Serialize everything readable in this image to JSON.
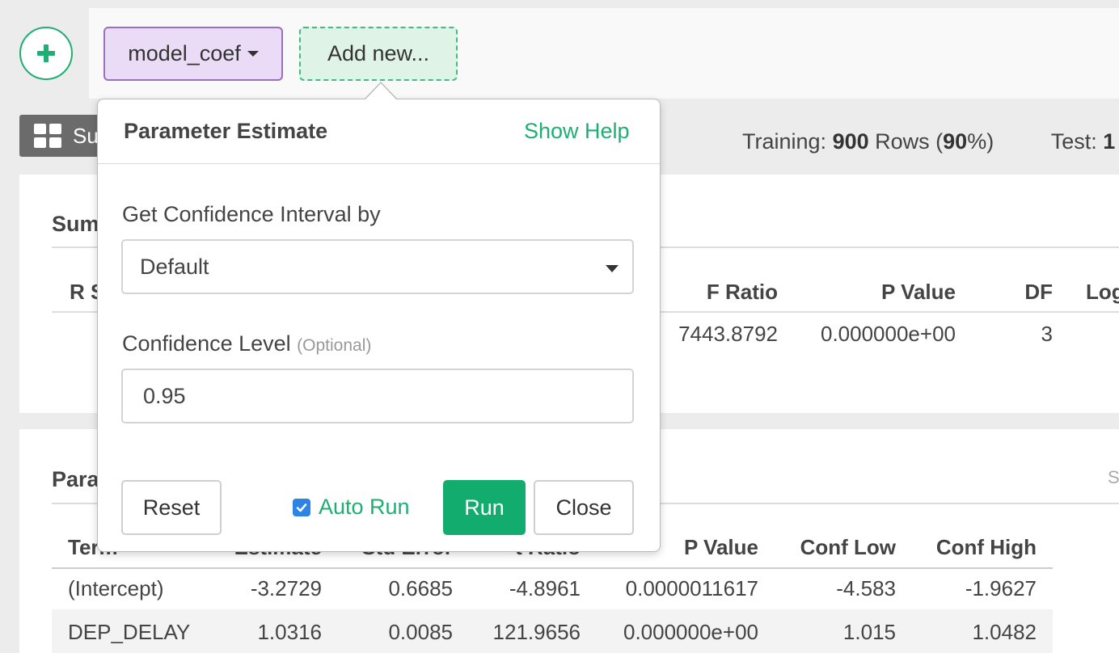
{
  "header": {
    "step_tab_label": "model_coef",
    "add_new_label": "Add new..."
  },
  "view_bar": {
    "summary_button_label": "Su",
    "training_label": "Training:",
    "training_rows": "900",
    "training_rows_word": "Rows (",
    "training_pct": "90",
    "training_pct_suffix": "%)",
    "test_label": "Test:",
    "test_value": "1"
  },
  "summary_card": {
    "title": "Sum",
    "columns": [
      "R S",
      "F Ratio",
      "P Value",
      "DF",
      "Log"
    ],
    "values": {
      "f_ratio": "7443.8792",
      "p_value": "0.000000e+00",
      "df": "3"
    }
  },
  "param_card": {
    "title": "Para",
    "right_edge_text": "S",
    "columns": [
      "Term",
      "Estimate",
      "Std Error",
      "t Ratio",
      "P Value",
      "Conf Low",
      "Conf High"
    ],
    "rows": [
      [
        "(Intercept)",
        "-3.2729",
        "0.6685",
        "-4.8961",
        "0.0000011617",
        "-4.583",
        "-1.9627"
      ],
      [
        "DEP_DELAY",
        "1.0316",
        "0.0085",
        "121.9656",
        "0.000000e+00",
        "1.015",
        "1.0482"
      ]
    ]
  },
  "popover": {
    "title": "Parameter Estimate",
    "show_help": "Show Help",
    "ci_label": "Get Confidence Interval by",
    "ci_value": "Default",
    "conf_label": "Confidence Level",
    "conf_optional": "(Optional)",
    "conf_value": "0.95",
    "reset_label": "Reset",
    "auto_run_label": "Auto Run",
    "auto_run_checked": true,
    "run_label": "Run",
    "close_label": "Close"
  },
  "colors": {
    "accent_green": "#1fae73",
    "run_button": "#12ad6e",
    "step_tab_bg": "#eadcf6",
    "step_tab_border": "#9b6fc0",
    "add_new_bg": "#dff3e6",
    "checkbox": "#2d84e5"
  },
  "icons": [
    "plus-icon",
    "caret-down-icon",
    "grid-icon",
    "checkbox-checked-icon"
  ]
}
